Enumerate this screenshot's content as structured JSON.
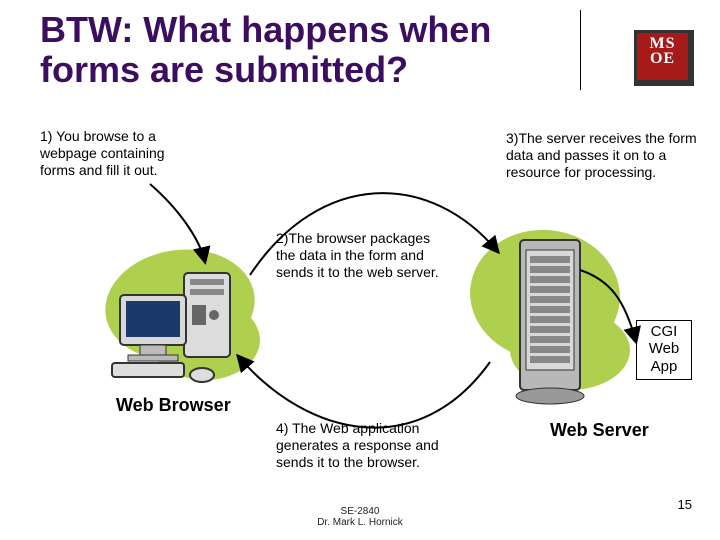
{
  "title": "BTW: What happens when forms are submitted?",
  "logo": {
    "line1": "MS",
    "line2": "OE"
  },
  "steps": {
    "s1": "1) You browse to a webpage containing forms and fill it out.",
    "s2": "2)The browser packages the data in the form and sends it to the web server.",
    "s3": "3)The server receives the form data and passes it on to a resource for processing.",
    "s4": "4) The Web application generates a response and sends it to the browser."
  },
  "labels": {
    "browser": "Web Browser",
    "server": "Web Server",
    "cgi": "CGI Web App"
  },
  "footer": {
    "course": "SE-2840",
    "author": "Dr. Mark L. Hornick",
    "page": "15"
  }
}
